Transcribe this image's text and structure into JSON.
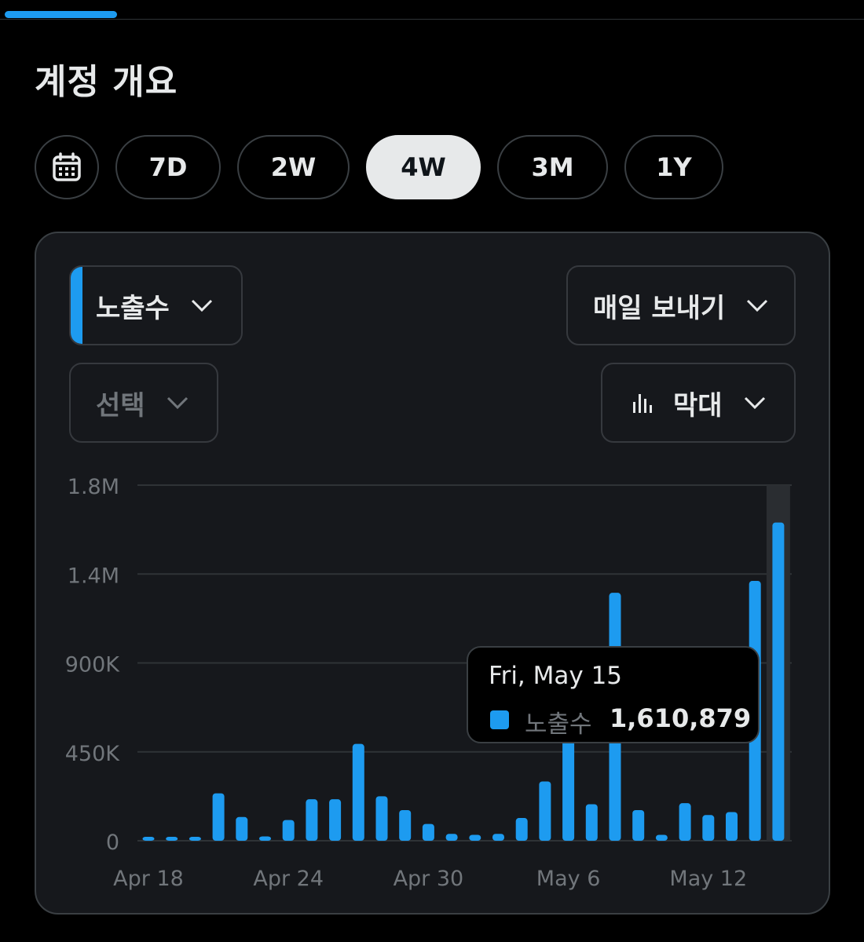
{
  "header": {
    "title": "계정 개요"
  },
  "range": {
    "calendar_icon": "calendar-icon",
    "options": [
      "7D",
      "2W",
      "4W",
      "3M",
      "1Y"
    ],
    "selected": "4W"
  },
  "controls": {
    "metric_label": "노출수",
    "export_label": "매일 보내기",
    "compare_label": "선택",
    "charttype_label": "막대"
  },
  "colors": {
    "accent": "#1d9bf0",
    "background": "#000000",
    "panel": "#16181c",
    "selected_pill": "#e7e9ea"
  },
  "chart_data": {
    "type": "bar",
    "categories": [
      "Apr 18",
      "Apr 19",
      "Apr 20",
      "Apr 21",
      "Apr 22",
      "Apr 23",
      "Apr 24",
      "Apr 25",
      "Apr 26",
      "Apr 27",
      "Apr 28",
      "Apr 29",
      "Apr 30",
      "May 1",
      "May 2",
      "May 3",
      "May 4",
      "May 5",
      "May 6",
      "May 7",
      "May 8",
      "May 9",
      "May 10",
      "May 11",
      "May 12",
      "May 13",
      "May 14",
      "May 15"
    ],
    "series": [
      {
        "name": "노출수",
        "values": [
          5000,
          7000,
          15000,
          240000,
          120000,
          22000,
          105000,
          210000,
          210000,
          490000,
          225000,
          155000,
          85000,
          35000,
          30000,
          35000,
          115000,
          300000,
          570000,
          185000,
          1255000,
          155000,
          30000,
          190000,
          130000,
          145000,
          1315000,
          1610879
        ]
      }
    ],
    "x_tick_labels": [
      "Apr 18",
      "Apr 24",
      "Apr 30",
      "May 6",
      "May 12"
    ],
    "y_tick_labels": [
      "0",
      "450K",
      "900K",
      "1.4M",
      "1.8M"
    ],
    "y_tick_values": [
      0,
      450000,
      900000,
      1350000,
      1800000
    ],
    "ylim": [
      0,
      1800000
    ],
    "grid": true,
    "highlighted_index": 27,
    "tooltip": {
      "date": "Fri, May 15",
      "series": "노출수",
      "value": "1,610,879"
    }
  }
}
